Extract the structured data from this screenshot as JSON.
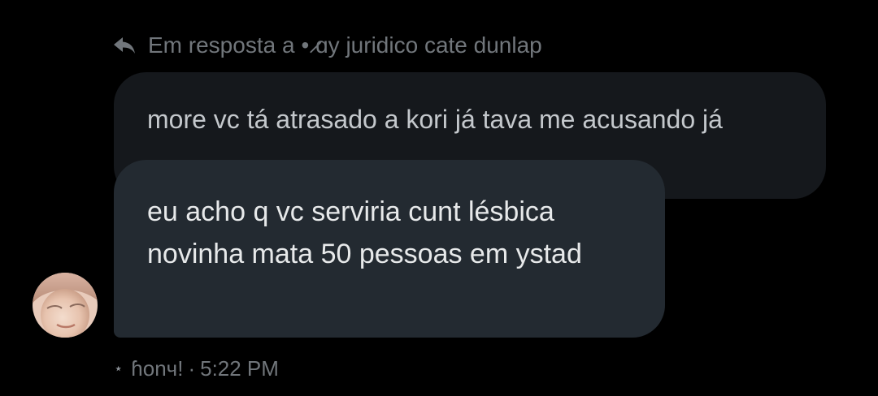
{
  "reply_header": {
    "icon": "reply-arrow-icon",
    "prefix": "Em resposta a",
    "username": "• ̷ɑy juridico cate dunlap"
  },
  "quoted_message": {
    "text": "more vc tá atrasado a kori já tava me acusando já"
  },
  "message": {
    "text": "eu acho q vc serviria cunt lésbica novinha mata 50 pessoas em ystad"
  },
  "avatar": {
    "icon": "user-avatar-photo"
  },
  "meta": {
    "star_icon": "⋆",
    "sender": "ɦonч!",
    "separator": "·",
    "time": "5:22 PM"
  },
  "colors": {
    "background": "#000000",
    "quoted_bubble": "#15181c",
    "message_bubble": "#232a31",
    "secondary_text": "#71767b",
    "primary_text": "#e7e9ea"
  }
}
